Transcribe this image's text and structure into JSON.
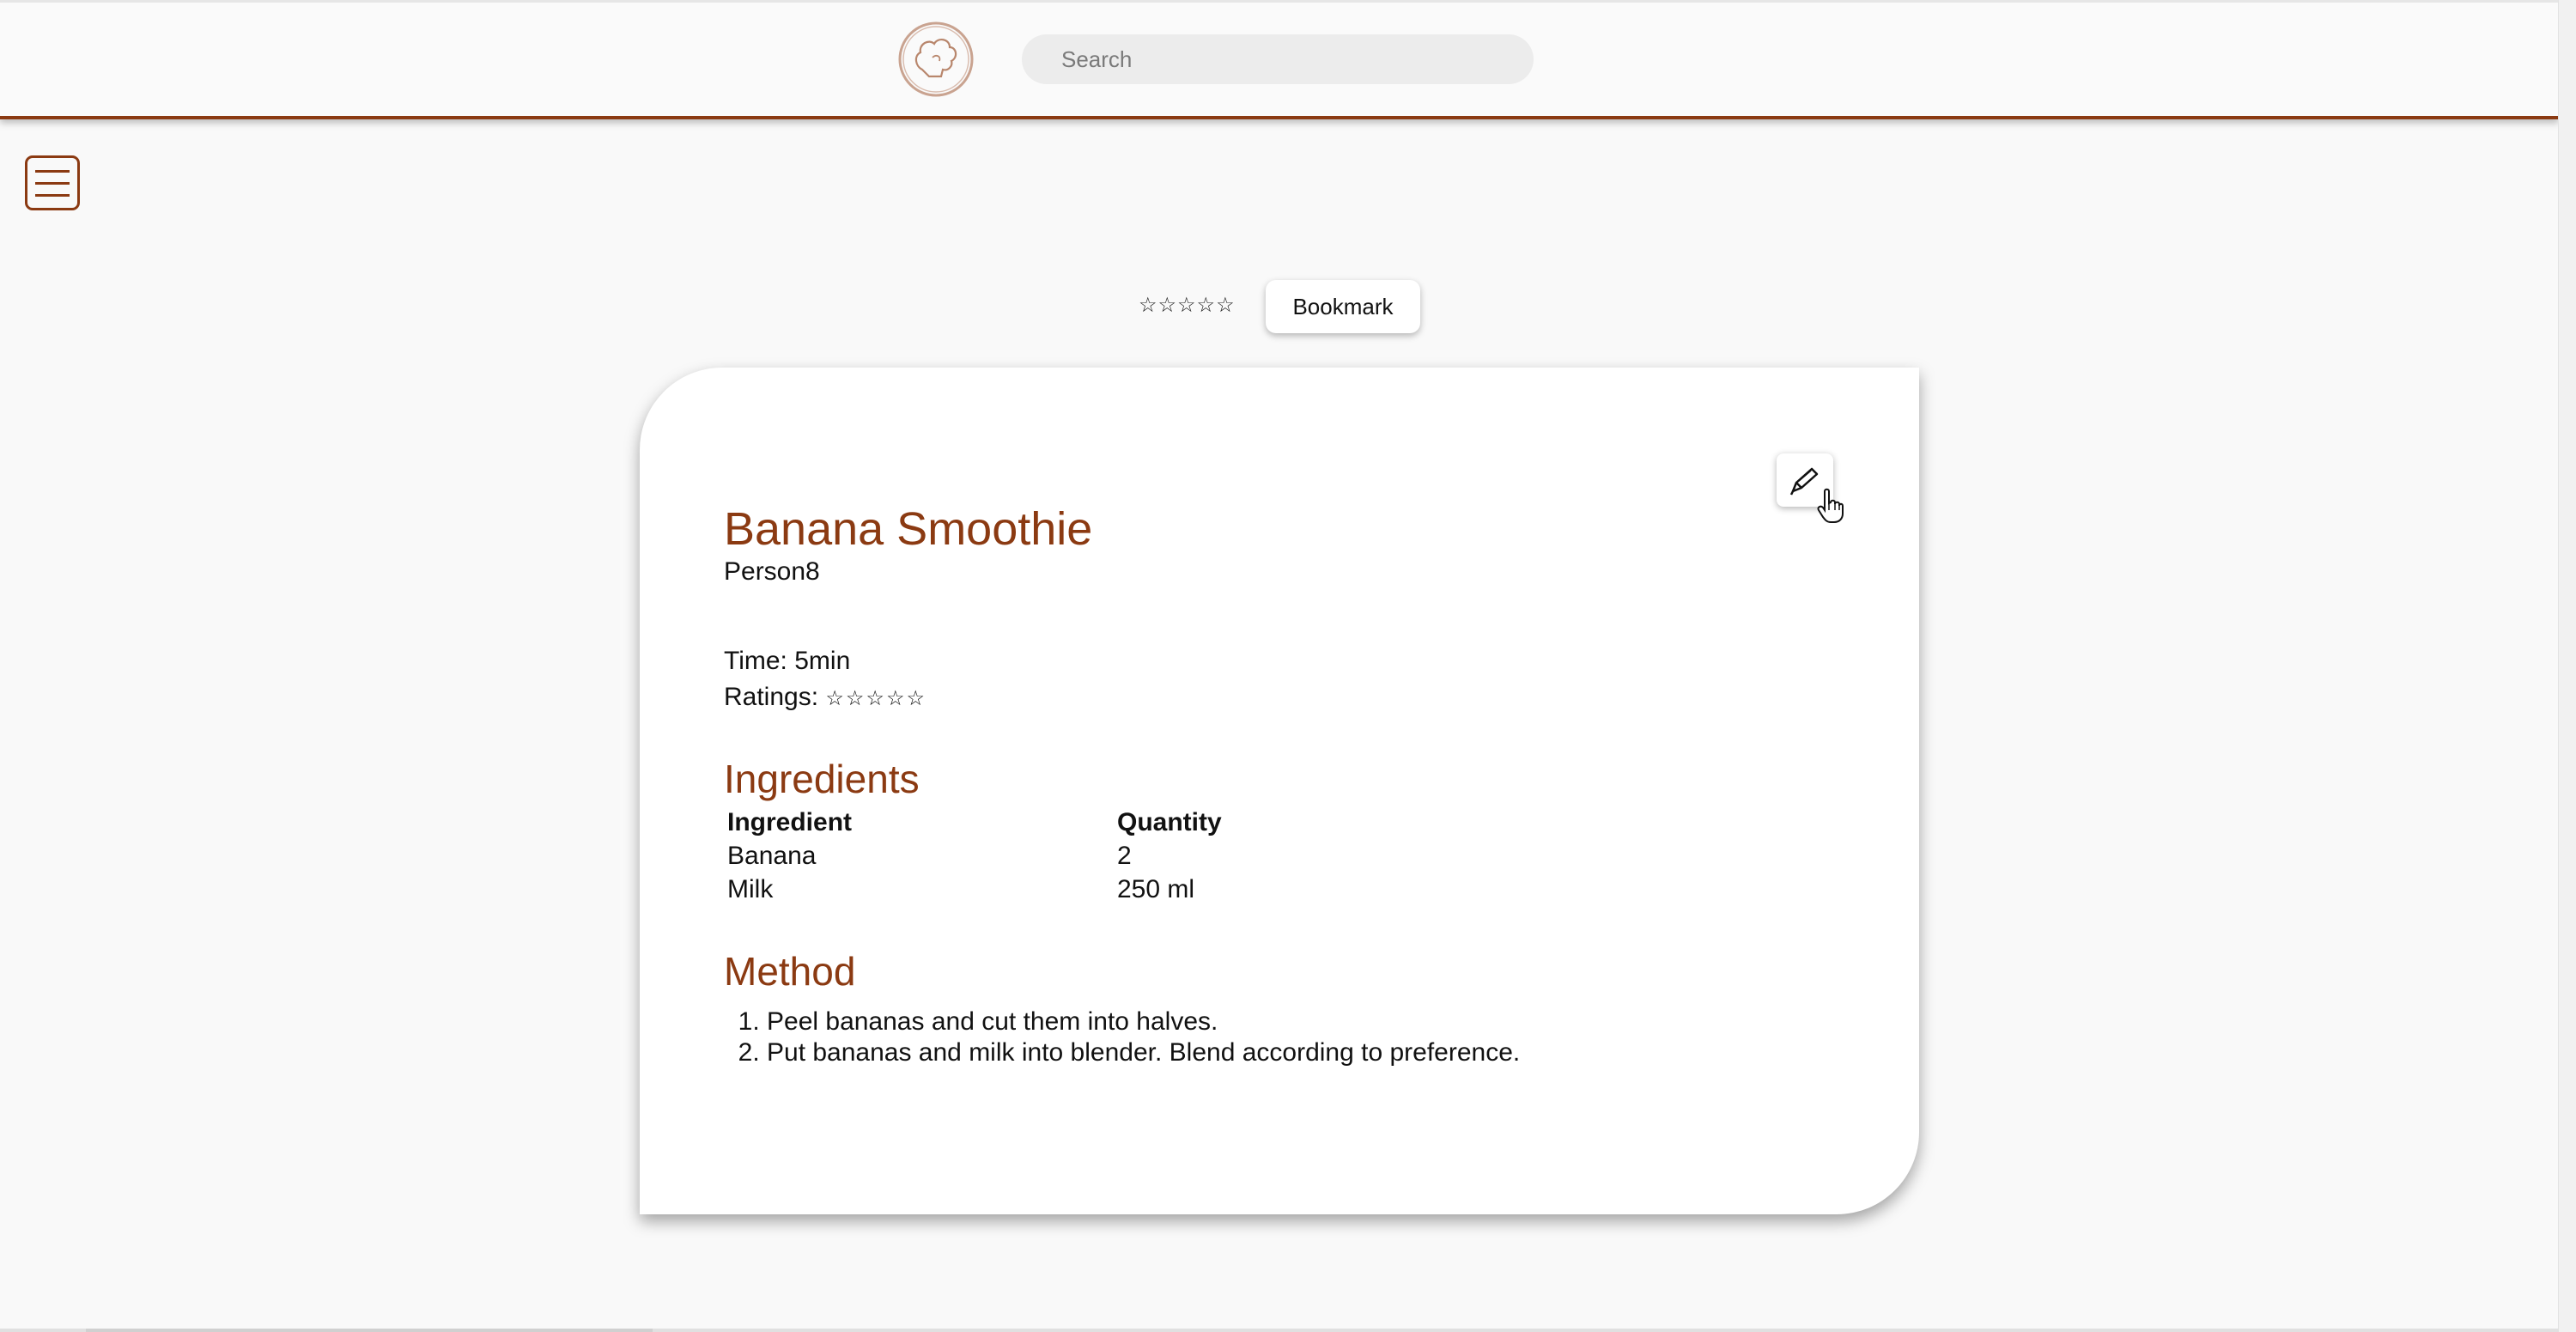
{
  "header": {
    "search_placeholder": "Search"
  },
  "toolbar": {
    "top_rating_stars": "☆☆☆☆☆",
    "bookmark_label": "Bookmark"
  },
  "recipe": {
    "title": "Banana Smoothie",
    "author": "Person8",
    "time_label": "Time: ",
    "time_value": "5min",
    "ratings_label": "Ratings: ",
    "ratings_stars": "☆☆☆☆☆",
    "ingredients_heading": "Ingredients",
    "ingredients_table": {
      "headers": [
        "Ingredient",
        "Quantity"
      ],
      "rows": [
        [
          "Banana",
          "2"
        ],
        [
          "Milk",
          "250 ml"
        ]
      ]
    },
    "method_heading": "Method",
    "method_steps": [
      "Peel bananas and cut them into halves.",
      "Put bananas and milk into blender. Blend according to preference."
    ]
  },
  "colors": {
    "accent": "#8b3a12",
    "background": "#f9f9f9",
    "card": "#ffffff"
  },
  "icons": {
    "logo": "chef-hat-logo-icon",
    "menu": "hamburger-menu-icon",
    "edit": "pen-icon",
    "cursor": "hand-pointer-icon"
  }
}
